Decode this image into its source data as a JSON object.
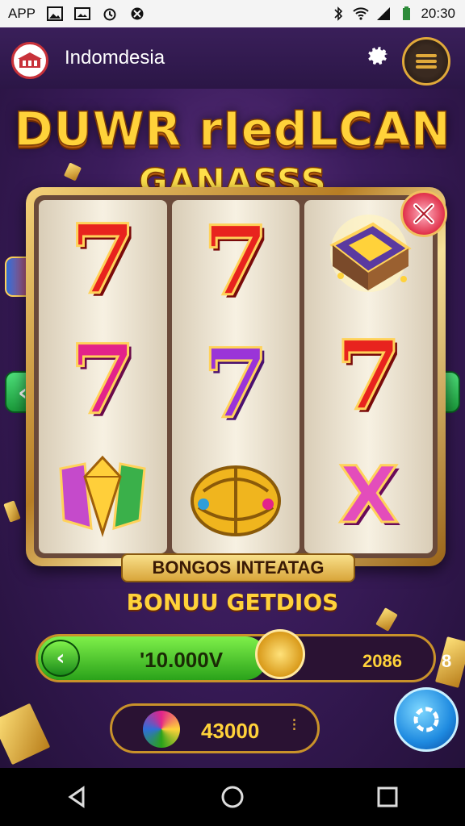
{
  "status_bar": {
    "app_label": "APP",
    "time": "20:30"
  },
  "app_bar": {
    "app_name": "Indomdesia"
  },
  "game": {
    "title_line1": "DUWR rIedLCAN",
    "title_line2": "GANASSS",
    "reels": [
      [
        "7",
        "7",
        "wild-gem-icon"
      ],
      [
        "7",
        "7",
        "golden-orb-icon"
      ],
      [
        "treasure-chest-icon",
        "7",
        "X"
      ]
    ],
    "bonus_banner": "BONGOS INTEATAG",
    "bonus_label": "BONUU GETDIOS",
    "meter": {
      "value_text": "'10.000V",
      "fill_fraction": 0.58,
      "right_value": "2086",
      "right_count": "8"
    },
    "balance": {
      "value": "43000",
      "dots": "⁝"
    }
  },
  "colors": {
    "accent_gold": "#ffd23a",
    "background_purple": "#3b1c5c",
    "green_button": "#2aa21a",
    "spin_blue": "#1e8ae0"
  }
}
